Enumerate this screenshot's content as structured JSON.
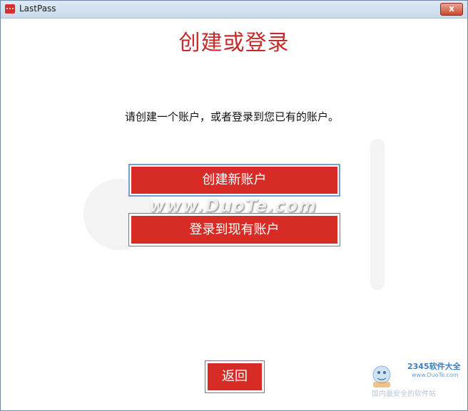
{
  "window": {
    "title": "LastPass",
    "close_label": "x"
  },
  "main": {
    "heading": "创建或登录",
    "instruction": "请创建一个账户，或者登录到您已有的账户。",
    "create_button_label": "创建新账户",
    "login_button_label": "登录到现有账户",
    "back_button_label": "返回"
  },
  "watermarks": {
    "duote": "www.DuoTe.com",
    "corner_brand": "2345软件大全",
    "corner_url": "www.DuoTe.com",
    "corner_slogan": "国内最安全的软件站"
  },
  "colors": {
    "accent": "#d72b25",
    "heading": "#c62a2a"
  }
}
